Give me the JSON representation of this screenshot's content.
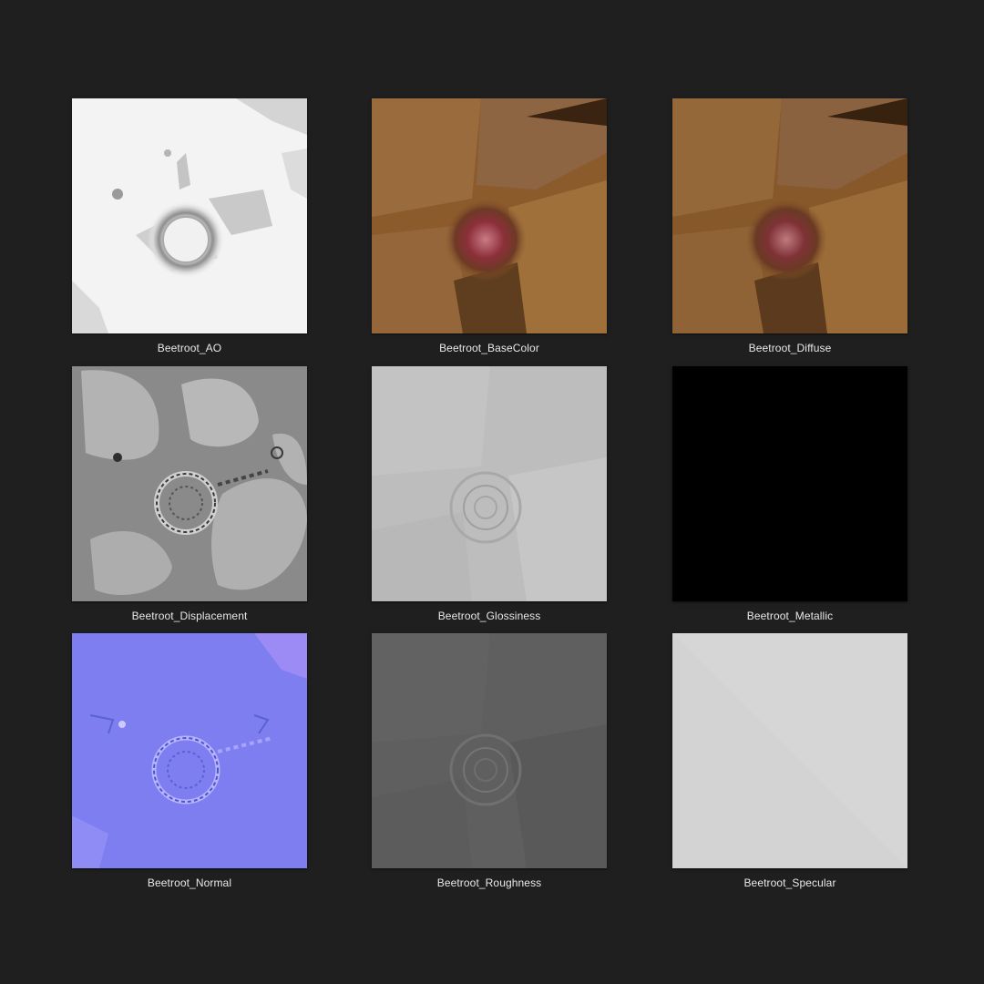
{
  "background_color": "#1f1f1f",
  "label_color": "#e8e8e8",
  "textures": [
    {
      "label": "Beetroot_AO",
      "kind": "ao",
      "base_color": "#f2f2f2"
    },
    {
      "label": "Beetroot_BaseColor",
      "kind": "basecolor",
      "base_color": "#8a5a2a"
    },
    {
      "label": "Beetroot_Diffuse",
      "kind": "basecolor",
      "base_color": "#8a5a2a"
    },
    {
      "label": "Beetroot_Displacement",
      "kind": "displacement",
      "base_color": "#8a8a8a"
    },
    {
      "label": "Beetroot_Glossiness",
      "kind": "glossiness",
      "base_color": "#bcbcbc"
    },
    {
      "label": "Beetroot_Metallic",
      "kind": "metallic",
      "base_color": "#000000"
    },
    {
      "label": "Beetroot_Normal",
      "kind": "normal",
      "base_color": "#7f7ff0"
    },
    {
      "label": "Beetroot_Roughness",
      "kind": "roughness",
      "base_color": "#5e5e5e"
    },
    {
      "label": "Beetroot_Specular",
      "kind": "specular",
      "base_color": "#d2d2d2"
    }
  ]
}
